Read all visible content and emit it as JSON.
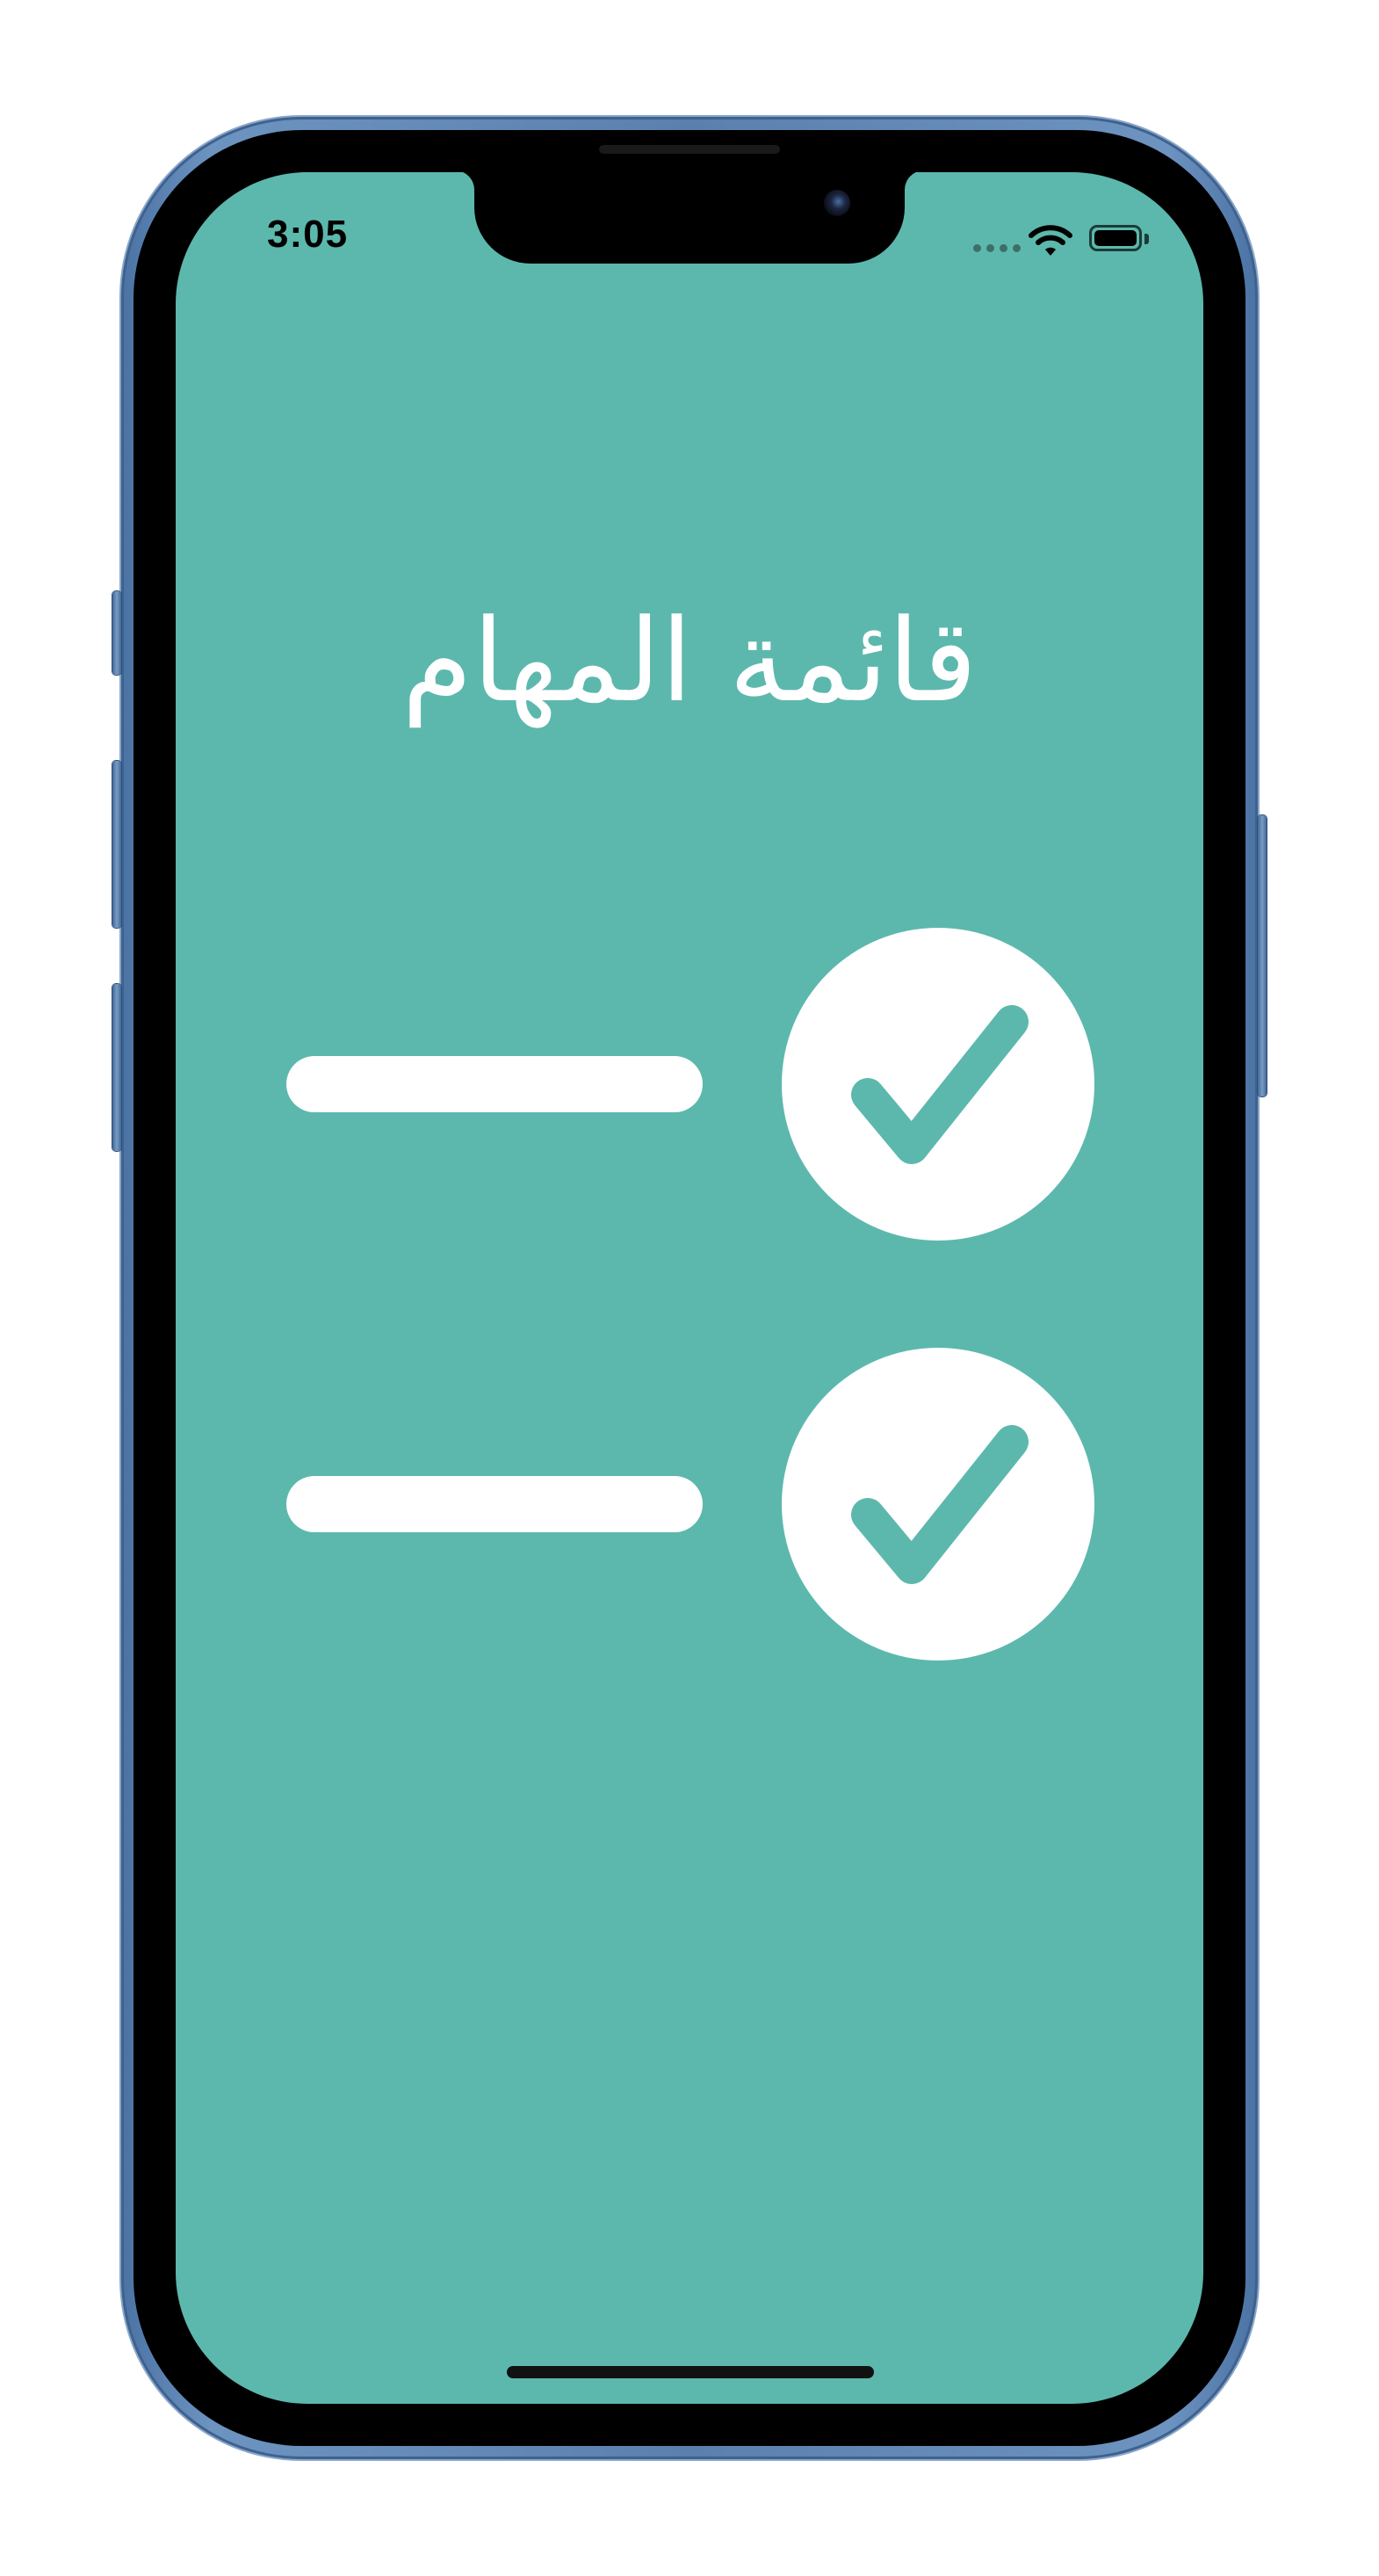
{
  "status_bar": {
    "time": "3:05",
    "wifi_icon": "wifi-icon",
    "battery_icon": "battery-icon"
  },
  "screen": {
    "title": "قائمة المهام",
    "background_color": "#5cb8ad",
    "tasks": [
      {
        "name": "task-1",
        "completed": true,
        "check_icon": "checkmark-icon"
      },
      {
        "name": "task-2",
        "completed": true,
        "check_icon": "checkmark-icon"
      }
    ]
  }
}
